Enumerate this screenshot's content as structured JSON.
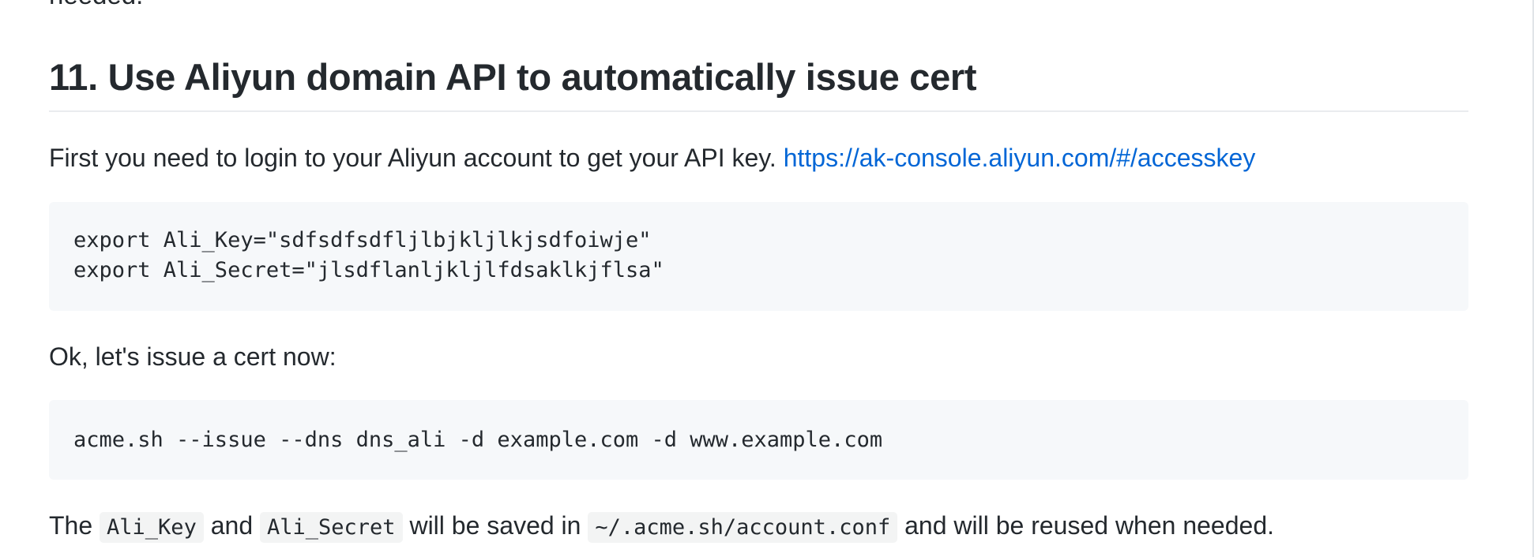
{
  "previous_paragraph_tail": "needed.",
  "section": {
    "heading": "11. Use Aliyun domain API to automatically issue cert",
    "intro_text": "First you need to login to your Aliyun account to get your API key. ",
    "intro_link": "https://ak-console.aliyun.com/#/accesskey",
    "code_block_1": [
      "export Ali_Key=\"sdfsdfsdfljlbjkljlkjsdfoiwje\"",
      "export Ali_Secret=\"jlsdflanljkljlfdsaklkjflsa\""
    ],
    "issue_text": "Ok, let's issue a cert now:",
    "code_block_2": [
      "acme.sh --issue --dns dns_ali -d example.com -d www.example.com"
    ],
    "footer": {
      "t1": "The ",
      "code1": "Ali_Key",
      "t2": " and ",
      "code2": "Ali_Secret",
      "t3": " will be saved in ",
      "code3": "~/.acme.sh/account.conf",
      "t4": " and will be reused when needed."
    }
  },
  "colors": {
    "text": "#24292e",
    "link": "#0366d6",
    "code_bg": "#f6f8fa",
    "rule": "#eaecef"
  }
}
